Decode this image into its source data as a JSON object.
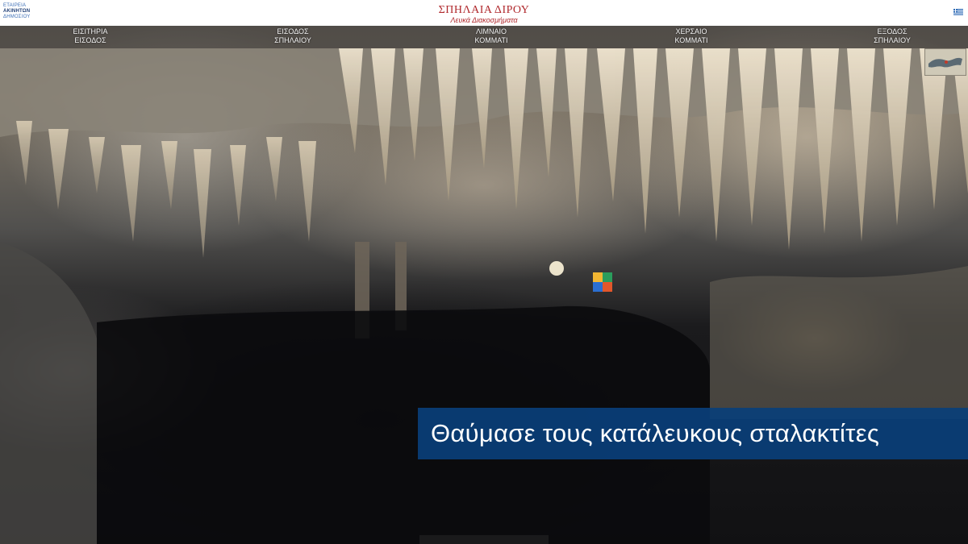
{
  "header": {
    "logo_lines": [
      "ΕΤΑΙΡΕΙΑ",
      "ΑΚΙΝΗΤΩΝ",
      "ΔΗΜΟΣΙΟΥ"
    ],
    "title": "ΣΠΗΛΑΙΑ ΔΙΡΟΥ",
    "subtitle": "Λευκά Διακοσμήματα",
    "language_flag": "greek-flag-icon"
  },
  "nav": {
    "items": [
      {
        "line1": "ΕΙΣΙΤΗΡΙΑ",
        "line2": "ΕΙΣΟΔΟΣ"
      },
      {
        "line1": "ΕΙΣΟΔΟΣ",
        "line2": "ΣΠΗΛΑΙΟΥ"
      },
      {
        "line1": "ΛΙΜΝΑΙΟ",
        "line2": "ΚΟΜΜΑΤΙ"
      },
      {
        "line1": "ΧΕΡΣΑΙΟ",
        "line2": "ΚΟΜΜΑΤΙ"
      },
      {
        "line1": "ΕΞΟΔΟΣ",
        "line2": "ΣΠΗΛΑΙΟΥ"
      }
    ]
  },
  "caption": {
    "text": "Θαύμασε τους κατάλευκους σταλακτίτες"
  },
  "colors": {
    "title_red": "#b0292d",
    "caption_blue": "#0a3e78",
    "logo_blue": "#1f3f77"
  }
}
